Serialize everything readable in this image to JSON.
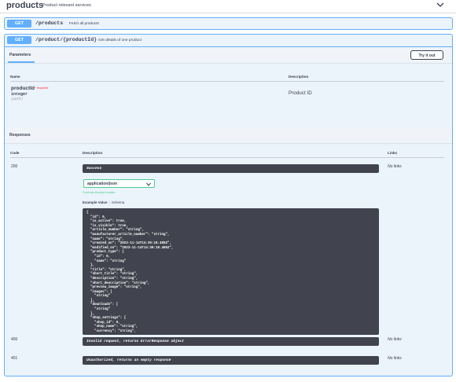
{
  "tag": {
    "name": "products",
    "description": "Product relevant services",
    "chevron_icon": "chevron-down-icon"
  },
  "operations": [
    {
      "method": "GET",
      "path": "/products",
      "summary": "Fetch all products"
    },
    {
      "method": "GET",
      "path": "/product/{productId}",
      "summary": "Get details of one product"
    }
  ],
  "parameters": {
    "title": "Parameters",
    "try_it_out": "Try it out",
    "col_name": "Name",
    "col_description": "Description",
    "param": {
      "name": "productId",
      "required": "* required",
      "type": "integer",
      "in": "(path)",
      "description": "Product ID"
    }
  },
  "responses": {
    "title": "Responses",
    "col_code": "Code",
    "col_description": "Description",
    "col_links": "Links",
    "media_type": "application/json",
    "accept_note": "Controls Accept header.",
    "tab_example": "Example Value",
    "tab_schema": "Schema",
    "items": [
      {
        "code": "200",
        "description": "Success",
        "links": "No links"
      },
      {
        "code": "400",
        "description": "Invalid request, returns ErrorResponse object",
        "links": "No links"
      },
      {
        "code": "401",
        "description": "Unauthorized, returns an empty response",
        "links": "No links"
      }
    ],
    "example_json": "{\n  \"id\": 0,\n  \"is_active\": true,\n  \"is_visible\": true,\n  \"article_number\": \"string\",\n  \"manufacturer_article_number\": \"string\",\n  \"name\": \"string\",\n  \"created_on\": \"2023-11-14T14:39:18.485Z\",\n  \"modified_on\": \"2023-11-14T14:39:18.485Z\",\n  \"product_type\": {\n    \"id\": 0,\n    \"name\": \"string\"\n  },\n  \"title\": \"string\",\n  \"short_title\": \"string\",\n  \"description\": \"string\",\n  \"short_description\": \"string\",\n  \"preview_image\": \"string\",\n  \"images\": [\n    \"string\"\n  ],\n  \"downloads\": [\n    \"string\"\n  ],\n  \"shop_settings\": {\n    \"shop_id\": 0,\n    \"shop_name\": \"string\",\n    \"currency\": \"string\","
  },
  "colors": {
    "get": "#61affe",
    "get_bg": "#ebf3fb",
    "dark": "#41444e",
    "green": "#49cc90",
    "required": "#ff2b2b"
  }
}
